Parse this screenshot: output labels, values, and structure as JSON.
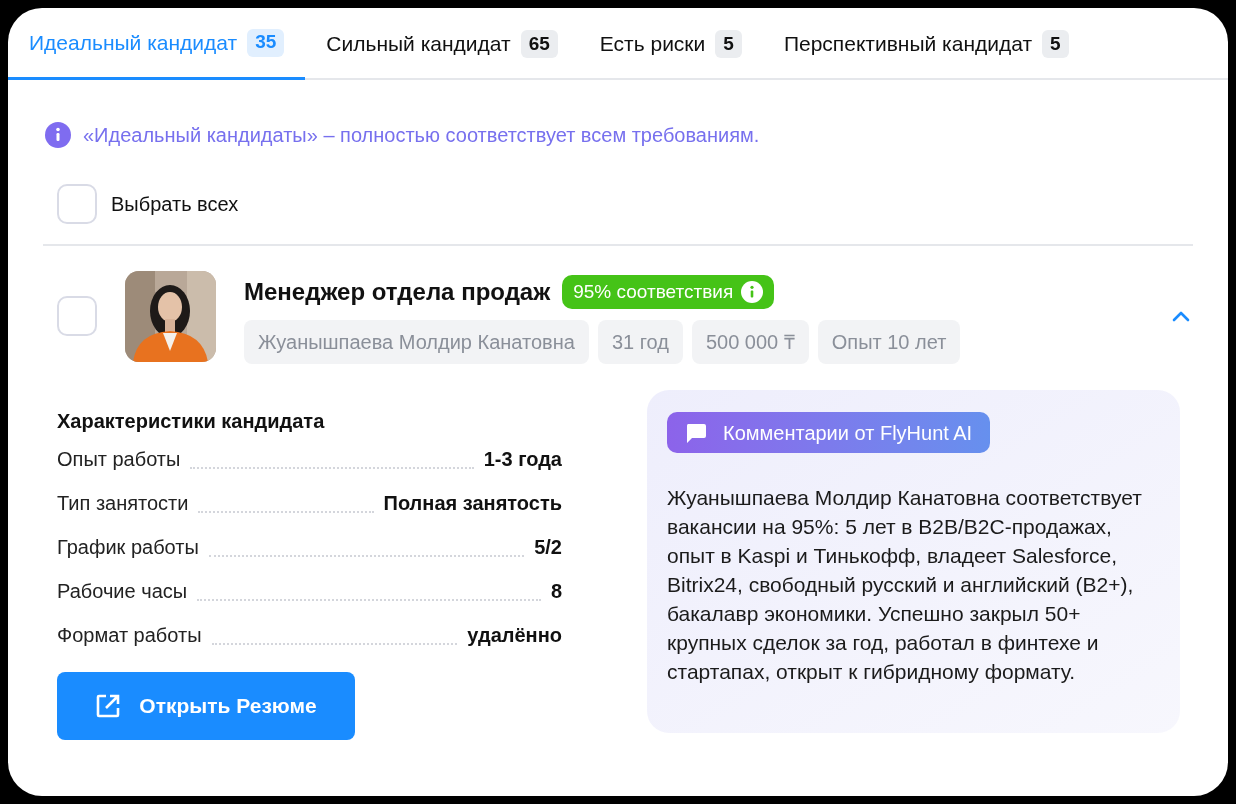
{
  "tabs": [
    {
      "label": "Идеальный кандидат",
      "count": "35",
      "selected": true
    },
    {
      "label": "Сильный кандидат",
      "count": "65",
      "selected": false
    },
    {
      "label": "Есть риски",
      "count": "5",
      "selected": false
    },
    {
      "label": "Перспективный кандидат",
      "count": "5",
      "selected": false
    }
  ],
  "info": "«Идеальный кандидаты» – полностью соответствует всем требованиям.",
  "select_all": {
    "label": "Выбрать всех",
    "checked": false
  },
  "candidate": {
    "checked": false,
    "expanded": true,
    "photo": {
      "kind": "picture"
    },
    "title": "Менеджер отдела продаж",
    "match": "95% соответствия",
    "chips": [
      "Жуанышпаева Молдир Канатовна",
      "31 год",
      "500 000 ₸",
      "Опыт 10 лет"
    ],
    "characteristics": {
      "heading": "Характеристики кандидата",
      "rows": [
        {
          "label": "Опыт работы",
          "value": "1-3 года"
        },
        {
          "label": "Тип занятости",
          "value": "Полная занятость"
        },
        {
          "label": "График работы",
          "value": "5/2"
        },
        {
          "label": "Рабочие часы",
          "value": "8"
        },
        {
          "label": "Формат работы",
          "value": "удалённо"
        }
      ]
    },
    "open_button": "Открыть Резюме",
    "ai_comment": {
      "badge": "Комментарии от FlyHunt AI",
      "text": "Жуанышпаева Молдир Канатовна соответствует вакансии на 95%: 5 лет в B2B/B2C-продажах, опыт в Kaspi и Тинькофф, владеет Salesforce, Bitrix24, свободный русский и английский (B2+), бакалавр экономики. Успешно закрыл 50+ крупных сделок за год, работал в финтехе и стартапах, открыт к гибридному формату."
    }
  }
}
